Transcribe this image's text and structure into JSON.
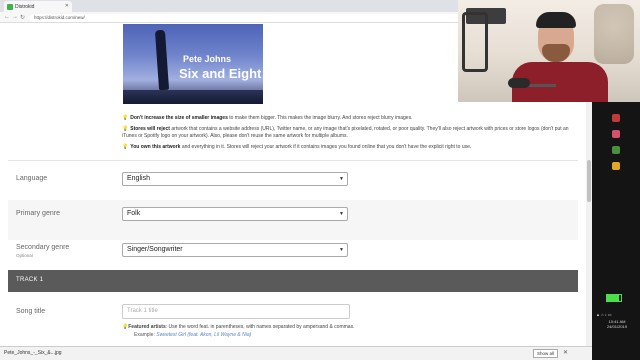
{
  "browser": {
    "tab_title": "Distrokid",
    "url": "https://distrokid.com/new/"
  },
  "artwork": {
    "artist": "Pete Johns",
    "title": "Six and Eight"
  },
  "notes": [
    {
      "bold": "Don't increase the size of smaller images",
      "rest": " to make them bigger. This makes the image blurry. And stores reject blurry images."
    },
    {
      "bold": "Stores will reject",
      "rest": " artwork that contains a website address (URL), Twitter name, or any image that's pixelated, rotated, or poor quality. They'll also reject artwork with prices or store logos (don't put an iTunes or Spotify logo on your artwork). Also, please don't reuse the same artwork for multiple albums."
    },
    {
      "bold": "You own this artwork",
      "rest": " and everything in it. Stores will reject your artwork if it contains images you found online that you don't have the explicit right to use."
    }
  ],
  "form": {
    "language_label": "Language",
    "language_value": "English",
    "primary_genre_label": "Primary genre",
    "primary_genre_value": "Folk",
    "secondary_genre_label": "Secondary genre",
    "secondary_genre_sublabel": "Optional",
    "secondary_genre_value": "Singer/Songwriter"
  },
  "track": {
    "header": "TRACK 1",
    "song_title_label": "Song title",
    "song_title_placeholder": "Track 1 title",
    "featured_bold": "Featured artists",
    "featured_rest": ": Use the word feat. in parentheses, with names separated by ampersand & commas.",
    "example_label": "Example: ",
    "example_value": "Sweetest Girl (feat. Akon, Lil Wayne & Nia)"
  },
  "downloads": {
    "item": "Pete_Johns_-_Six_&...jpg",
    "show_all": "Show all"
  },
  "tray": {
    "time": "10:41 AM",
    "date": "24/01/2019"
  },
  "colors": {
    "track_bar": "#5a5a5a",
    "example_link": "#5a86c9"
  }
}
